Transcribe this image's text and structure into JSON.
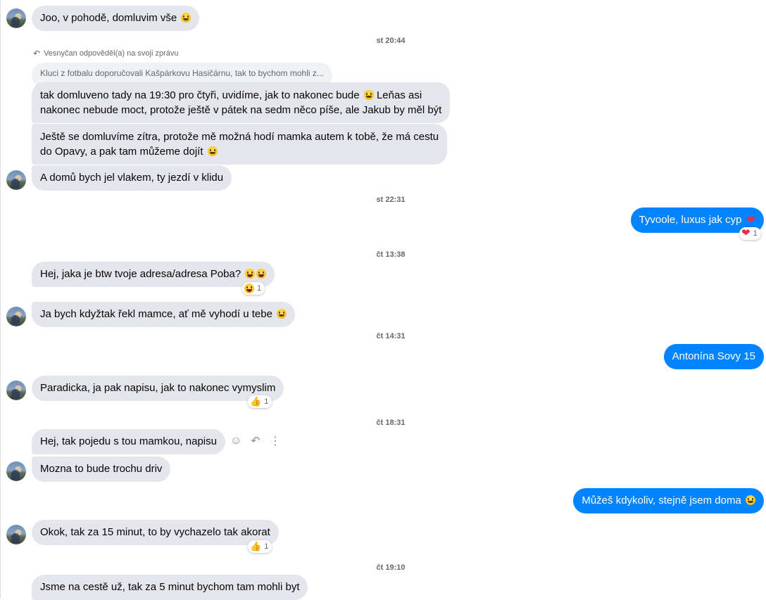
{
  "reply": {
    "label": "​Vesnyčan odpověděl(a) na svoji zprávu",
    "quoted_text": "Kluci z fotbalu doporučovali Kašpárkovu Hasičárnu, tak to bychom mohli z..."
  },
  "timestamps": [
    "st 20:44",
    "st 22:31",
    "čt 13:38",
    "čt 14:31",
    "čt 18:31",
    "čt 19:10"
  ],
  "messages": [
    {
      "text": "Joo, v pohodě, domluvim vše"
    },
    {
      "line1": "tak domluveno tady na 19:30 pro čtyři, uvidíme, jak to nakonec bude",
      "line1b": "Leňas asi",
      "line2": "nakonec nebude moct, protože ještě v pátek na sedm něco píše, ale Jakub by měl být"
    },
    {
      "line1": "Ještě se domluvíme zítra, protože mě možná hodí mamka autem k tobě, že má cestu",
      "line2": "do Opavy, a pak tam můžeme dojít"
    },
    {
      "text": "A domů bych jel vlakem, ty jezdí v klidu"
    },
    {
      "text": "Tyvoole, luxus jak cyp",
      "reaction_count": "1"
    },
    {
      "text": "Hej, jaka je btw tvoje adresa/adresa Poba?",
      "reaction_count": "1"
    },
    {
      "text": "Ja bych kdyžtak řekl mamce, ať mě vyhodí u tebe"
    },
    {
      "text": "Antonína Sovy 15"
    },
    {
      "text": "Paradicka, ja pak napisu, jak to nakonec vymyslim",
      "reaction_count": "1"
    },
    {
      "text": "Hej, tak pojedu s tou mamkou, napisu"
    },
    {
      "text": "Mozna to bude trochu driv"
    },
    {
      "text": "Můžeš kdykoliv, stejně jsem doma"
    },
    {
      "text": "Okok, tak za 15 minut, to by vychazelo tak akorat",
      "reaction_count": "1"
    },
    {
      "text": "Jsme na cestě už, tak za 5 minut bychom tam mohli byt"
    }
  ],
  "icons": {
    "reply": "reply-arrow-icon",
    "react": "smiley-icon",
    "more": "more-vertical-icon",
    "emoji": "grinning-face",
    "heart": "red-heart",
    "laugh": "laughing-face",
    "thumb": "thumbs-up"
  },
  "colors": {
    "incoming_bubble": "#e4e6eb",
    "outgoing_bubble": "#0084ff",
    "timestamp": "#65676b",
    "heart": "#f02849"
  }
}
